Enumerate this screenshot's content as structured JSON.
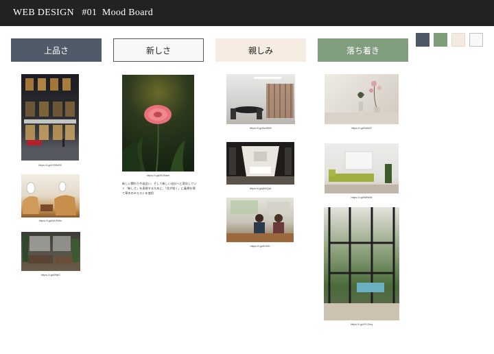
{
  "header": {
    "title": "WEB DESIGN   #01  Mood Board"
  },
  "palette": [
    {
      "name": "slate",
      "color": "#4d5966"
    },
    {
      "name": "sage",
      "color": "#7f9c7c"
    },
    {
      "name": "cream",
      "color": "#f4eadf"
    },
    {
      "name": "white",
      "color": "#f8f8f8"
    }
  ],
  "columns": [
    {
      "label": "上品さ",
      "bg": "#4f5b68",
      "fg": "#ffffff",
      "images": [
        {
          "subject": "storefront-night-photo",
          "caption": "https://i.gd/Y55xFA"
        },
        {
          "subject": "private-jet-interior-photo",
          "caption": "https://i.gd/WJ9Wx"
        },
        {
          "subject": "lounge-interior-photo",
          "caption": "https://i.gd/fHjfC"
        }
      ]
    },
    {
      "label": "新しさ",
      "bg": "#f8f8f8",
      "fg": "#222222",
      "images": [
        {
          "subject": "pink-flower-photo",
          "caption": "https://i.gd/f8JNam"
        }
      ],
      "description": "新しい関わりや出会い、そして新しい自分へと変化していく「新しさ」を表現するために、「花が咲く」に着想を得て草木のテキストを使用"
    },
    {
      "label": "親しみ",
      "bg": "#f6ece1",
      "fg": "#222222",
      "images": [
        {
          "subject": "office-dining-photo",
          "caption": "https://i.gd/wd5Wr"
        },
        {
          "subject": "meeting-room-photo",
          "caption": "https://i.gd/jk5Qat"
        },
        {
          "subject": "people-in-kitchen-photo",
          "caption": "https://i.gd/KHDI"
        }
      ]
    },
    {
      "label": "落ち着き",
      "bg": "#809d7e",
      "fg": "#ffffff",
      "images": [
        {
          "subject": "vase-still-life-photo",
          "caption": "https://i.gd/Wkl47"
        },
        {
          "subject": "green-sofa-room-photo",
          "caption": "https://i.gd/MN0le"
        },
        {
          "subject": "tall-window-pool-photo",
          "caption": "https://i.gd/YLDeq"
        }
      ]
    }
  ]
}
